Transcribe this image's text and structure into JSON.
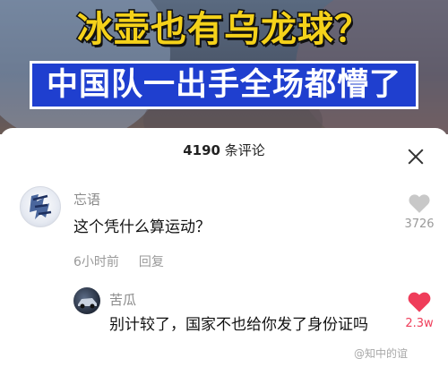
{
  "video": {
    "headline_1": "冰壶也有乌龙球？",
    "headline_2": "中国队一出手全场都懵了"
  },
  "comments_panel": {
    "count": "4190",
    "count_suffix": " 条评论"
  },
  "comments": [
    {
      "username": "忘语",
      "text": "这个凭什么算运动？",
      "time": "6小时前",
      "reply_label": "回复",
      "likes": "3726",
      "liked": false,
      "like_color": "#c8c8c8"
    },
    {
      "username": "苦瓜",
      "text": "别计较了，国家不也给你发了身份证吗",
      "likes": "2.3w",
      "liked": true,
      "like_color": "#ef3d5a"
    }
  ],
  "watermark": "@知中的谊"
}
